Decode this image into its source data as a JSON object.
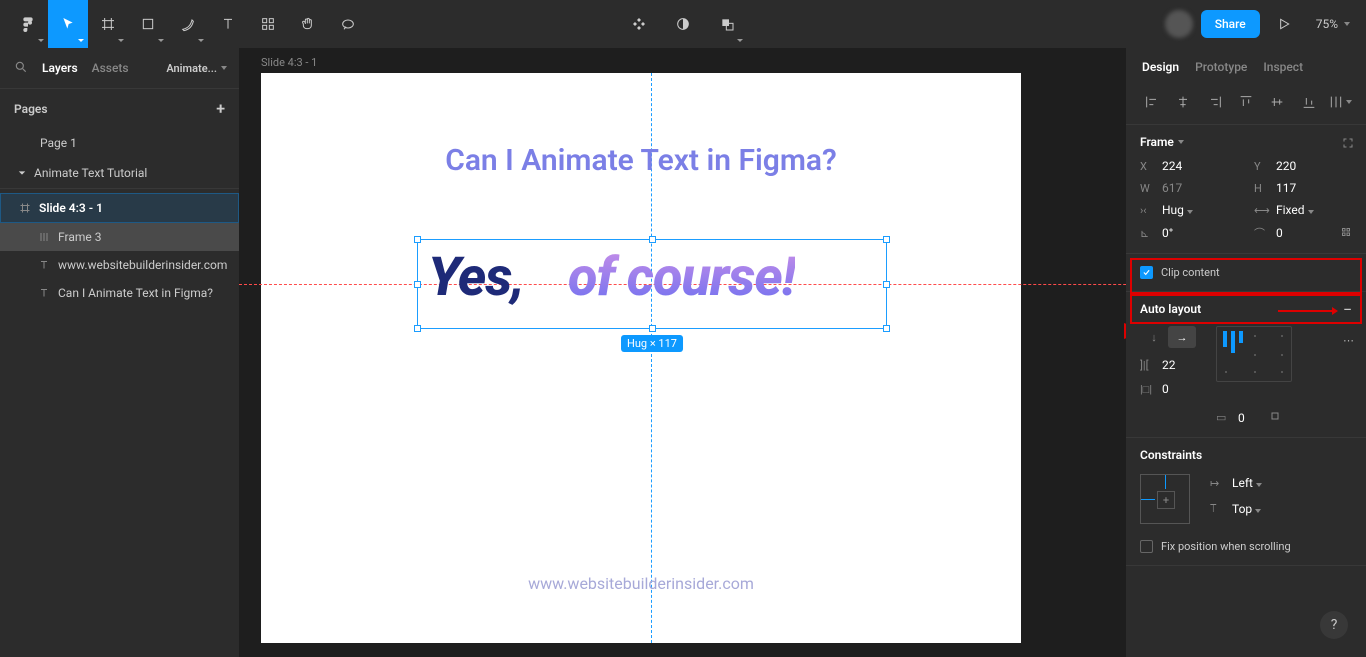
{
  "toolbar": {
    "zoom": "75%"
  },
  "share_label": "Share",
  "left": {
    "tabs": {
      "layers": "Layers",
      "assets": "Assets"
    },
    "file_name": "Animate...",
    "pages_label": "Pages",
    "page1": "Page 1",
    "page_parent": "Animate Text Tutorial",
    "layers": {
      "root": "Slide 4:3 - 1",
      "frame3": "Frame 3",
      "url": "www.websitebuilderinsider.com",
      "title": "Can I Animate Text in Figma?"
    }
  },
  "canvas": {
    "frame_label": "Slide 4:3 - 1",
    "title": "Can I Animate Text in Figma?",
    "yes": "Yes,",
    "course": "of course!",
    "dims": "Hug × 117",
    "footer": "www.websitebuilderinsider.com"
  },
  "right": {
    "tabs": {
      "design": "Design",
      "prototype": "Prototype",
      "inspect": "Inspect"
    },
    "frame_section": "Frame",
    "x_label": "X",
    "x_val": "224",
    "y_label": "Y",
    "y_val": "220",
    "w_label": "W",
    "w_val": "617",
    "h_label": "H",
    "h_val": "117",
    "hug": "Hug",
    "fixed": "Fixed",
    "rot": "0°",
    "rad": "0",
    "clip": "Clip content",
    "autolayout": "Auto layout",
    "spacing": "22",
    "pad_h": "0",
    "pad_v": "0",
    "constraints": "Constraints",
    "c_left": "Left",
    "c_top": "Top",
    "fix_scroll": "Fix position when scrolling"
  }
}
